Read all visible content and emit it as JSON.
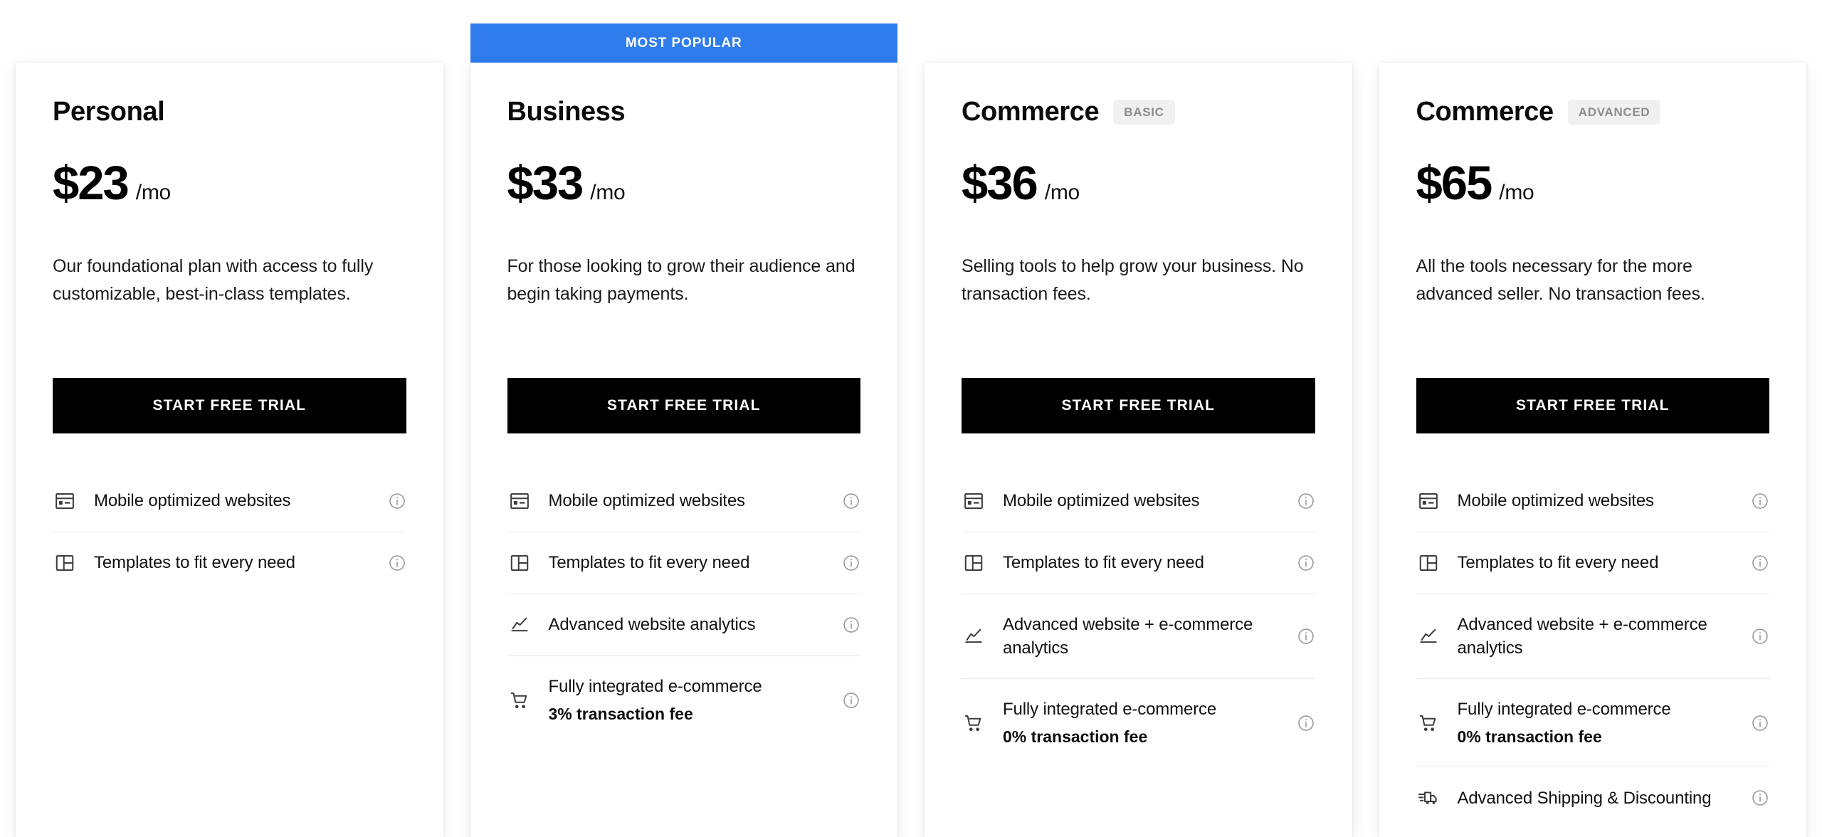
{
  "banner": {
    "label": "MOST POPULAR",
    "color": "#2f7ded"
  },
  "cta_label": "START FREE TRIAL",
  "plans": [
    {
      "name": "Personal",
      "badge": "",
      "price": "$23",
      "period": "/mo",
      "description": "Our foundational plan with access to fully customizable, best-in-class templates.",
      "featured": false,
      "features": [
        {
          "icon": "browser-window-icon",
          "label": "Mobile optimized websites",
          "sub": "",
          "info": "info-icon"
        },
        {
          "icon": "layout-grid-icon",
          "label": "Templates to fit every need",
          "sub": "",
          "info": "info-icon"
        }
      ]
    },
    {
      "name": "Business",
      "badge": "",
      "price": "$33",
      "period": "/mo",
      "description": "For those looking to grow their audience and begin taking payments.",
      "featured": true,
      "features": [
        {
          "icon": "browser-window-icon",
          "label": "Mobile optimized websites",
          "sub": "",
          "info": "info-icon"
        },
        {
          "icon": "layout-grid-icon",
          "label": "Templates to fit every need",
          "sub": "",
          "info": "info-icon"
        },
        {
          "icon": "analytics-chart-icon",
          "label": "Advanced website analytics",
          "sub": "",
          "info": "info-icon"
        },
        {
          "icon": "shopping-cart-icon",
          "label": "Fully integrated e-commerce",
          "sub": "3% transaction fee",
          "info": "info-icon"
        }
      ]
    },
    {
      "name": "Commerce",
      "badge": "BASIC",
      "price": "$36",
      "period": "/mo",
      "description": "Selling tools to help grow your business. No transaction fees.",
      "featured": false,
      "features": [
        {
          "icon": "browser-window-icon",
          "label": "Mobile optimized websites",
          "sub": "",
          "info": "info-icon"
        },
        {
          "icon": "layout-grid-icon",
          "label": "Templates to fit every need",
          "sub": "",
          "info": "info-icon"
        },
        {
          "icon": "analytics-chart-icon",
          "label": "Advanced website + e-commerce analytics",
          "sub": "",
          "info": "info-icon"
        },
        {
          "icon": "shopping-cart-icon",
          "label": "Fully integrated e-commerce",
          "sub": "0% transaction fee",
          "info": "info-icon"
        }
      ]
    },
    {
      "name": "Commerce",
      "badge": "ADVANCED",
      "price": "$65",
      "period": "/mo",
      "description": "All the tools necessary for the more advanced seller. No transaction fees.",
      "featured": false,
      "features": [
        {
          "icon": "browser-window-icon",
          "label": "Mobile optimized websites",
          "sub": "",
          "info": "info-icon"
        },
        {
          "icon": "layout-grid-icon",
          "label": "Templates to fit every need",
          "sub": "",
          "info": "info-icon"
        },
        {
          "icon": "analytics-chart-icon",
          "label": "Advanced website + e-commerce analytics",
          "sub": "",
          "info": "info-icon"
        },
        {
          "icon": "shopping-cart-icon",
          "label": "Fully integrated e-commerce",
          "sub": "0% transaction fee",
          "info": "info-icon"
        },
        {
          "icon": "shipping-truck-icon",
          "label": "Advanced Shipping & Discounting",
          "sub": "",
          "info": "info-icon"
        }
      ]
    }
  ]
}
